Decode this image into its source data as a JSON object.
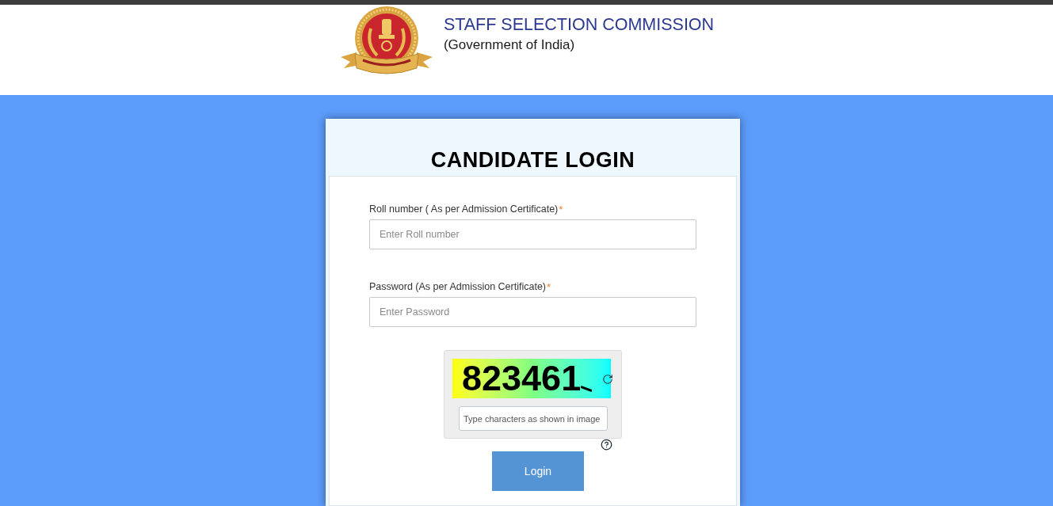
{
  "header": {
    "title": "STAFF SELECTION COMMISSION",
    "subtitle": "(Government of India)"
  },
  "login": {
    "title": "CANDIDATE LOGIN",
    "fields": [
      {
        "label": "Roll number ( As per Admission Certificate)",
        "required_mark": "*",
        "placeholder": "Enter Roll number"
      },
      {
        "label": "Password (As per Admission Certificate)",
        "required_mark": "*",
        "placeholder": "Enter Password"
      }
    ],
    "captcha": {
      "code": "823461",
      "placeholder": "Type characters as shown in image"
    },
    "submit": "Login"
  }
}
